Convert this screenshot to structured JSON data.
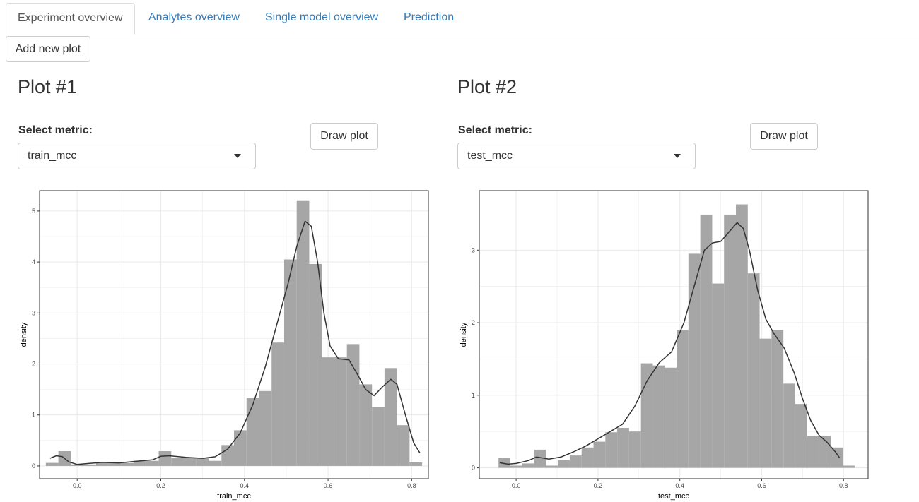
{
  "tabs": [
    {
      "label": "Experiment overview",
      "active": true
    },
    {
      "label": "Analytes overview",
      "active": false
    },
    {
      "label": "Single model overview",
      "active": false
    },
    {
      "label": "Prediction",
      "active": false
    }
  ],
  "add_plot_button": "Add new plot",
  "plots": [
    {
      "title": "Plot #1",
      "select_label": "Select metric:",
      "selected_metric": "train_mcc",
      "draw_button": "Draw plot"
    },
    {
      "title": "Plot #2",
      "select_label": "Select metric:",
      "selected_metric": "test_mcc",
      "draw_button": "Draw plot"
    }
  ],
  "colors": {
    "bar_fill": "#a6a6a6",
    "density_line": "#333333",
    "grid": "#ebebeb",
    "link": "#337ab7"
  },
  "icons": {
    "select_caret": "caret-down-icon"
  },
  "chart_data": [
    {
      "type": "bar",
      "xlabel": "train_mcc",
      "ylabel": "density",
      "xlim": [
        -0.09,
        0.84
      ],
      "ylim": [
        -0.25,
        5.4
      ],
      "xticks": [
        0.0,
        0.2,
        0.4,
        0.6,
        0.8
      ],
      "xtick_labels": [
        "0.0",
        "0.2",
        "0.4",
        "0.6",
        "0.8"
      ],
      "yticks": [
        0,
        1,
        2,
        3,
        4,
        5
      ],
      "ytick_labels": [
        "0",
        "1",
        "2",
        "3",
        "4",
        "5"
      ],
      "grid": true,
      "bin_width": 0.03,
      "bins": [
        {
          "x0": -0.075,
          "y": 0.06
        },
        {
          "x0": -0.045,
          "y": 0.29
        },
        {
          "x0": -0.015,
          "y": 0.03
        },
        {
          "x0": 0.015,
          "y": 0.03
        },
        {
          "x0": 0.045,
          "y": 0.06
        },
        {
          "x0": 0.075,
          "y": 0.06
        },
        {
          "x0": 0.105,
          "y": 0.06
        },
        {
          "x0": 0.135,
          "y": 0.1
        },
        {
          "x0": 0.165,
          "y": 0.1
        },
        {
          "x0": 0.195,
          "y": 0.29
        },
        {
          "x0": 0.225,
          "y": 0.16
        },
        {
          "x0": 0.255,
          "y": 0.16
        },
        {
          "x0": 0.285,
          "y": 0.16
        },
        {
          "x0": 0.315,
          "y": 0.1
        },
        {
          "x0": 0.345,
          "y": 0.41
        },
        {
          "x0": 0.375,
          "y": 0.7
        },
        {
          "x0": 0.405,
          "y": 1.34
        },
        {
          "x0": 0.435,
          "y": 1.47
        },
        {
          "x0": 0.465,
          "y": 2.42
        },
        {
          "x0": 0.495,
          "y": 4.05
        },
        {
          "x0": 0.525,
          "y": 5.21
        },
        {
          "x0": 0.555,
          "y": 3.96
        },
        {
          "x0": 0.585,
          "y": 2.13
        },
        {
          "x0": 0.615,
          "y": 2.13
        },
        {
          "x0": 0.645,
          "y": 2.39
        },
        {
          "x0": 0.675,
          "y": 1.6
        },
        {
          "x0": 0.705,
          "y": 1.15
        },
        {
          "x0": 0.735,
          "y": 1.92
        },
        {
          "x0": 0.765,
          "y": 0.8
        },
        {
          "x0": 0.795,
          "y": 0.07
        }
      ],
      "density": [
        [
          -0.065,
          0.15
        ],
        [
          -0.05,
          0.2
        ],
        [
          -0.035,
          0.18
        ],
        [
          -0.02,
          0.08
        ],
        [
          0.0,
          0.03
        ],
        [
          0.03,
          0.05
        ],
        [
          0.06,
          0.07
        ],
        [
          0.1,
          0.06
        ],
        [
          0.14,
          0.09
        ],
        [
          0.18,
          0.12
        ],
        [
          0.2,
          0.19
        ],
        [
          0.22,
          0.2
        ],
        [
          0.26,
          0.17
        ],
        [
          0.3,
          0.15
        ],
        [
          0.33,
          0.18
        ],
        [
          0.36,
          0.33
        ],
        [
          0.39,
          0.65
        ],
        [
          0.42,
          1.2
        ],
        [
          0.45,
          1.95
        ],
        [
          0.48,
          2.85
        ],
        [
          0.505,
          3.6
        ],
        [
          0.525,
          4.3
        ],
        [
          0.545,
          4.8
        ],
        [
          0.56,
          4.7
        ],
        [
          0.575,
          4.0
        ],
        [
          0.59,
          3.0
        ],
        [
          0.605,
          2.35
        ],
        [
          0.625,
          2.1
        ],
        [
          0.65,
          2.08
        ],
        [
          0.67,
          1.8
        ],
        [
          0.69,
          1.5
        ],
        [
          0.71,
          1.38
        ],
        [
          0.73,
          1.55
        ],
        [
          0.75,
          1.7
        ],
        [
          0.765,
          1.6
        ],
        [
          0.785,
          1.0
        ],
        [
          0.805,
          0.45
        ],
        [
          0.82,
          0.25
        ]
      ]
    },
    {
      "type": "bar",
      "xlabel": "test_mcc",
      "ylabel": "density",
      "xlim": [
        -0.09,
        0.86
      ],
      "ylim": [
        -0.15,
        3.82
      ],
      "xticks": [
        0.0,
        0.2,
        0.4,
        0.6,
        0.8
      ],
      "xtick_labels": [
        "0.0",
        "0.2",
        "0.4",
        "0.6",
        "0.8"
      ],
      "yticks": [
        0,
        1,
        2,
        3
      ],
      "ytick_labels": [
        "0",
        "1",
        "2",
        "3"
      ],
      "grid": true,
      "bin_width": 0.029,
      "bins": [
        {
          "x0": -0.043,
          "y": 0.14
        },
        {
          "x0": -0.014,
          "y": 0.03
        },
        {
          "x0": 0.015,
          "y": 0.06
        },
        {
          "x0": 0.044,
          "y": 0.25
        },
        {
          "x0": 0.073,
          "y": 0.03
        },
        {
          "x0": 0.102,
          "y": 0.11
        },
        {
          "x0": 0.131,
          "y": 0.17
        },
        {
          "x0": 0.16,
          "y": 0.28
        },
        {
          "x0": 0.189,
          "y": 0.36
        },
        {
          "x0": 0.218,
          "y": 0.49
        },
        {
          "x0": 0.247,
          "y": 0.55
        },
        {
          "x0": 0.276,
          "y": 0.5
        },
        {
          "x0": 0.305,
          "y": 1.44
        },
        {
          "x0": 0.334,
          "y": 1.41
        },
        {
          "x0": 0.363,
          "y": 1.38
        },
        {
          "x0": 0.392,
          "y": 1.9
        },
        {
          "x0": 0.421,
          "y": 2.95
        },
        {
          "x0": 0.45,
          "y": 3.49
        },
        {
          "x0": 0.479,
          "y": 2.54
        },
        {
          "x0": 0.508,
          "y": 3.49
        },
        {
          "x0": 0.537,
          "y": 3.63
        },
        {
          "x0": 0.566,
          "y": 2.68
        },
        {
          "x0": 0.595,
          "y": 1.78
        },
        {
          "x0": 0.624,
          "y": 1.9
        },
        {
          "x0": 0.653,
          "y": 1.16
        },
        {
          "x0": 0.682,
          "y": 0.88
        },
        {
          "x0": 0.711,
          "y": 0.44
        },
        {
          "x0": 0.74,
          "y": 0.44
        },
        {
          "x0": 0.769,
          "y": 0.28
        },
        {
          "x0": 0.798,
          "y": 0.03
        }
      ],
      "density": [
        [
          -0.04,
          0.07
        ],
        [
          -0.02,
          0.05
        ],
        [
          0.0,
          0.06
        ],
        [
          0.03,
          0.1
        ],
        [
          0.05,
          0.15
        ],
        [
          0.08,
          0.12
        ],
        [
          0.11,
          0.15
        ],
        [
          0.14,
          0.22
        ],
        [
          0.17,
          0.3
        ],
        [
          0.2,
          0.4
        ],
        [
          0.23,
          0.5
        ],
        [
          0.26,
          0.6
        ],
        [
          0.29,
          0.85
        ],
        [
          0.32,
          1.2
        ],
        [
          0.35,
          1.45
        ],
        [
          0.38,
          1.6
        ],
        [
          0.41,
          2.0
        ],
        [
          0.44,
          2.6
        ],
        [
          0.46,
          3.0
        ],
        [
          0.48,
          3.1
        ],
        [
          0.5,
          3.12
        ],
        [
          0.52,
          3.25
        ],
        [
          0.54,
          3.38
        ],
        [
          0.555,
          3.3
        ],
        [
          0.57,
          3.0
        ],
        [
          0.59,
          2.45
        ],
        [
          0.61,
          2.05
        ],
        [
          0.63,
          1.85
        ],
        [
          0.655,
          1.65
        ],
        [
          0.68,
          1.3
        ],
        [
          0.7,
          0.95
        ],
        [
          0.72,
          0.65
        ],
        [
          0.74,
          0.45
        ],
        [
          0.76,
          0.35
        ],
        [
          0.78,
          0.22
        ],
        [
          0.79,
          0.14
        ]
      ]
    }
  ]
}
